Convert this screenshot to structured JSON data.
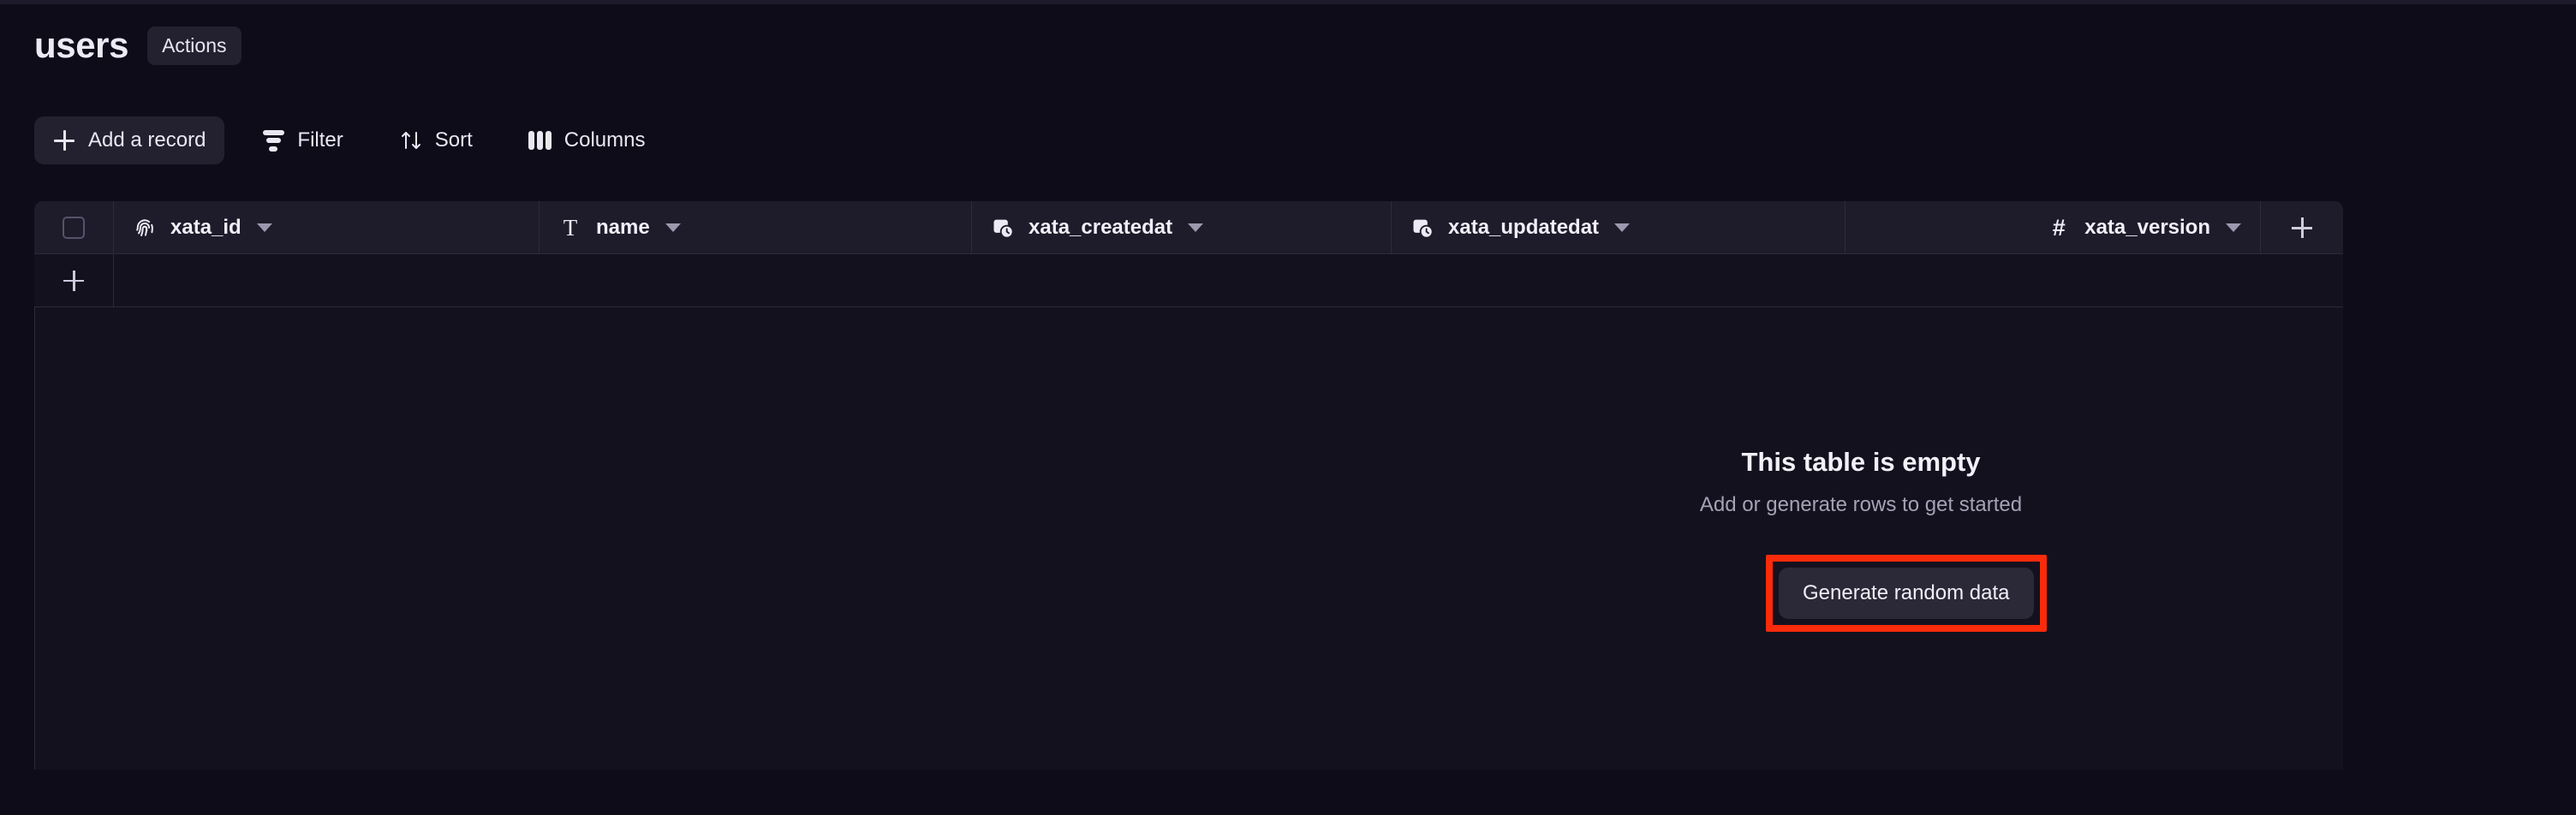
{
  "header": {
    "title": "users",
    "actions_label": "Actions"
  },
  "toolbar": {
    "add_record_label": "Add a record",
    "add_record_icon": "plus-icon",
    "filter_label": "Filter",
    "filter_icon": "filter-icon",
    "sort_label": "Sort",
    "sort_icon": "sort-arrows-icon",
    "columns_label": "Columns",
    "columns_icon": "columns-icon"
  },
  "table": {
    "select_all_checkbox": "select-all-checkbox",
    "add_column_icon": "plus-icon",
    "add_row_icon": "plus-icon",
    "columns": [
      {
        "label": "xata_id",
        "icon": "fingerprint-icon",
        "type": "identifier",
        "align": "left"
      },
      {
        "label": "name",
        "icon": "text-type-icon",
        "type": "string",
        "align": "left"
      },
      {
        "label": "xata_createdat",
        "icon": "calendar-clock-icon",
        "type": "datetime",
        "align": "left"
      },
      {
        "label": "xata_updatedat",
        "icon": "calendar-clock-icon",
        "type": "datetime",
        "align": "left"
      },
      {
        "label": "xata_version",
        "icon": "hash-icon",
        "type": "number",
        "align": "right"
      }
    ],
    "rows": []
  },
  "empty_state": {
    "title": "This table is empty",
    "subtitle": "Add or generate rows to get started",
    "button_label": "Generate random data"
  },
  "colors": {
    "page_background": "#0e0c19",
    "grid_background": "#13111e",
    "header_row_background": "#1e1c2b",
    "border": "#2c2a3b",
    "button_surface": "#23212f",
    "text_primary": "#f0eef7",
    "text_muted": "#a5a2b6",
    "highlight": "#fa2b0b"
  }
}
